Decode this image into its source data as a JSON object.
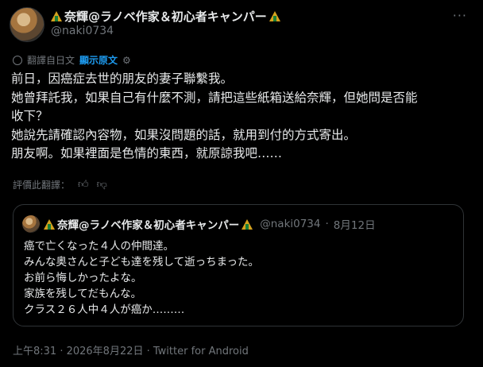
{
  "author": {
    "display_name": "奈輝@ラノベ作家＆初心者キャンパー",
    "handle": "@naki0734"
  },
  "more_label": "···",
  "translation": {
    "label": "翻譯自日文",
    "show_original": "顯示原文"
  },
  "post_lines": [
    "前日，因癌症去世的朋友的妻子聯繫我。",
    "她曾拜託我，如果自己有什麼不測，請把這些紙箱送給奈輝，但她問是否能",
    "收下？",
    "她說先請確認內容物，如果沒問題的話，就用到付的方式寄出。",
    "朋友啊。如果裡面是色情的東西，就原諒我吧……"
  ],
  "rate_translation_label": "評價此翻譯：",
  "quote": {
    "display_name": "奈輝@ラノベ作家＆初心者キャンパー",
    "handle": "@naki0734",
    "date": "8月12日",
    "lines": [
      "癌で亡くなった４人の仲間達。",
      "みんな奥さんと子ども達を残して逝っちまった。",
      "お前ら悔しかったよな。",
      "家族を残してだもんな。",
      "クラス２６人中４人が癌か………"
    ]
  },
  "footer": {
    "timestamp": "上午8:31 · 2026年8月22日 · Twitter for Android"
  }
}
